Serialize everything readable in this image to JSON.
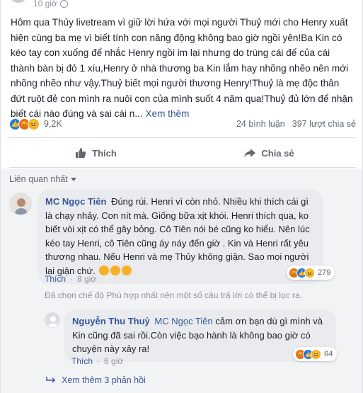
{
  "post": {
    "time": "10 giờ",
    "text": "Hôm qua Thủy livetream vì giữ lời hứa với mọi người Thuỷ mới cho Henry xuất hiện cùng ba mẹ vì biết tính con năng động không bao giờ ngồi yên!Ba Kin có kéo tay con xuống để nhắc Henry ngồi im lại nhưng do trúng cái đế của cái thành bàn bị đỏ 1 xíu,Henry ở nhà thương ba Kin lắm hay nhõng nhẽo nên mới nhõng nhẽo như vậy.Thuỷ biết mọi người thương Henry!Thuỷ là mẹ độc thân đứt ruột đẻ con mình ra nuôi con của mình suốt 4 năm qua!Thuỷ đủ lớn để nhận biết cái nào đúng và sai cái n...",
    "see_more": "Xem thêm",
    "reaction_count": "9,2K",
    "comments_count": "24 bình luận",
    "shares_count": "397 lượt chia sẻ",
    "reaction_icons": [
      "like",
      "angry",
      "haha"
    ]
  },
  "actions": {
    "like_label": "Thích",
    "share_label": "Chia sẻ"
  },
  "comments_sort": "Liên quan nhất",
  "comment1": {
    "author": "MC Ngọc Tiên",
    "text": "Đúng rùi. Henri vì còn nhỏ. Nhiều khi thích cái gì là chạy nhảy. Con nít mà. Giống bữa xịt khói. Henri thích qua, ko biết vòi xịt có thể gây bỏng. Cô Tiên nói bé cũng ko hiểu. Nên lúc kéo tay Henri, cô Tiên cũng áy náy đến giờ . Kin và Henri rất yêu thương nhau. Nếu Henri và mẹ Thủy không giận. Sao mọi người lại giận chứ.",
    "reaction_count": "279",
    "like_label": "Thích",
    "time": "8 giờ"
  },
  "filter_notice": "Đã chọn chế độ Phù hợp nhất nên một số câu trả lời có thể bị lọc ra.",
  "reply1": {
    "author": "Nguyễn Thu Thuỷ",
    "mention": "MC Ngọc Tiên",
    "text": "cảm ơn bạn dù gì mình và Kin cũng đã sai rồi.Còn việc bạo hành là không bao giờ có chuyện này xảy ra!",
    "reaction_count": "64",
    "like_label": "Thích",
    "time": "6 giờ"
  },
  "more_replies": "Xem thêm 3 phản hồi",
  "colors": {
    "link": "#385898",
    "like": "#1877f2",
    "angry": "#e9710f",
    "haha": "#f7b125"
  }
}
